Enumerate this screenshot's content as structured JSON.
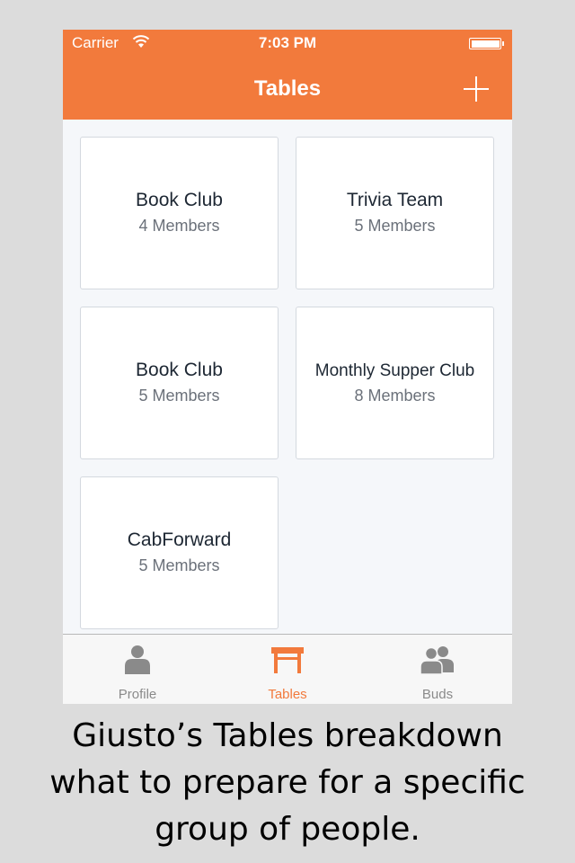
{
  "status_bar": {
    "carrier": "Carrier",
    "time": "7:03 PM",
    "wifi_icon": "wifi-icon",
    "battery_icon": "battery-icon"
  },
  "nav_bar": {
    "title": "Tables",
    "add_icon": "plus-icon",
    "color": "#f27a3c"
  },
  "tables": [
    {
      "name": "Book Club",
      "members": "4 Members"
    },
    {
      "name": "Trivia Team",
      "members": "5 Members"
    },
    {
      "name": "Book Club",
      "members": "5 Members"
    },
    {
      "name": "Monthly Supper Club",
      "members": "8 Members"
    },
    {
      "name": "CabForward",
      "members": "5 Members"
    }
  ],
  "tab_bar": {
    "tabs": [
      {
        "label": "Profile",
        "icon": "person-icon",
        "active": false
      },
      {
        "label": "Tables",
        "icon": "table-icon",
        "active": true
      },
      {
        "label": "Buds",
        "icon": "group-icon",
        "active": false
      }
    ],
    "active_color": "#f27a3c",
    "inactive_color": "#8a8a8a"
  },
  "caption": {
    "lines": [
      "Giusto’s Tables breakdown",
      "what to prepare for a specific",
      "group of people."
    ]
  }
}
